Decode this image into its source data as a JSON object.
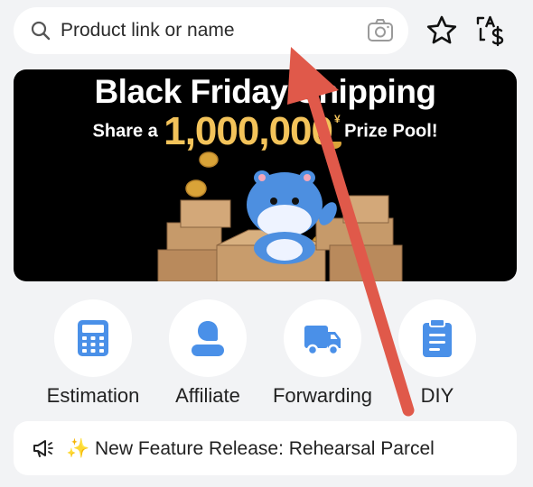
{
  "search": {
    "placeholder": "Product link or name",
    "icons": [
      "search-icon",
      "camera-icon"
    ]
  },
  "header_icons": [
    "star-icon",
    "currency-translate-icon"
  ],
  "banner": {
    "title": "Black Friday Shipping",
    "sub_prefix": "Share a",
    "amount": "1,000,000",
    "currency_mark": "¥",
    "sub_suffix": "Prize Pool!",
    "background": "#000000",
    "amount_color": "#f3c35a"
  },
  "quick_actions": [
    {
      "label": "Estimation",
      "icon": "calculator-icon"
    },
    {
      "label": "Affiliate",
      "icon": "person-icon"
    },
    {
      "label": "Forwarding",
      "icon": "truck-icon"
    },
    {
      "label": "DIY",
      "icon": "clipboard-icon"
    }
  ],
  "notice": {
    "text": "✨ New Feature Release: Rehearsal Parcel",
    "icon": "megaphone-icon"
  },
  "colors": {
    "accent_blue": "#4a90e8",
    "annotation_arrow": "#e0594a",
    "page_bg": "#f2f3f5"
  }
}
